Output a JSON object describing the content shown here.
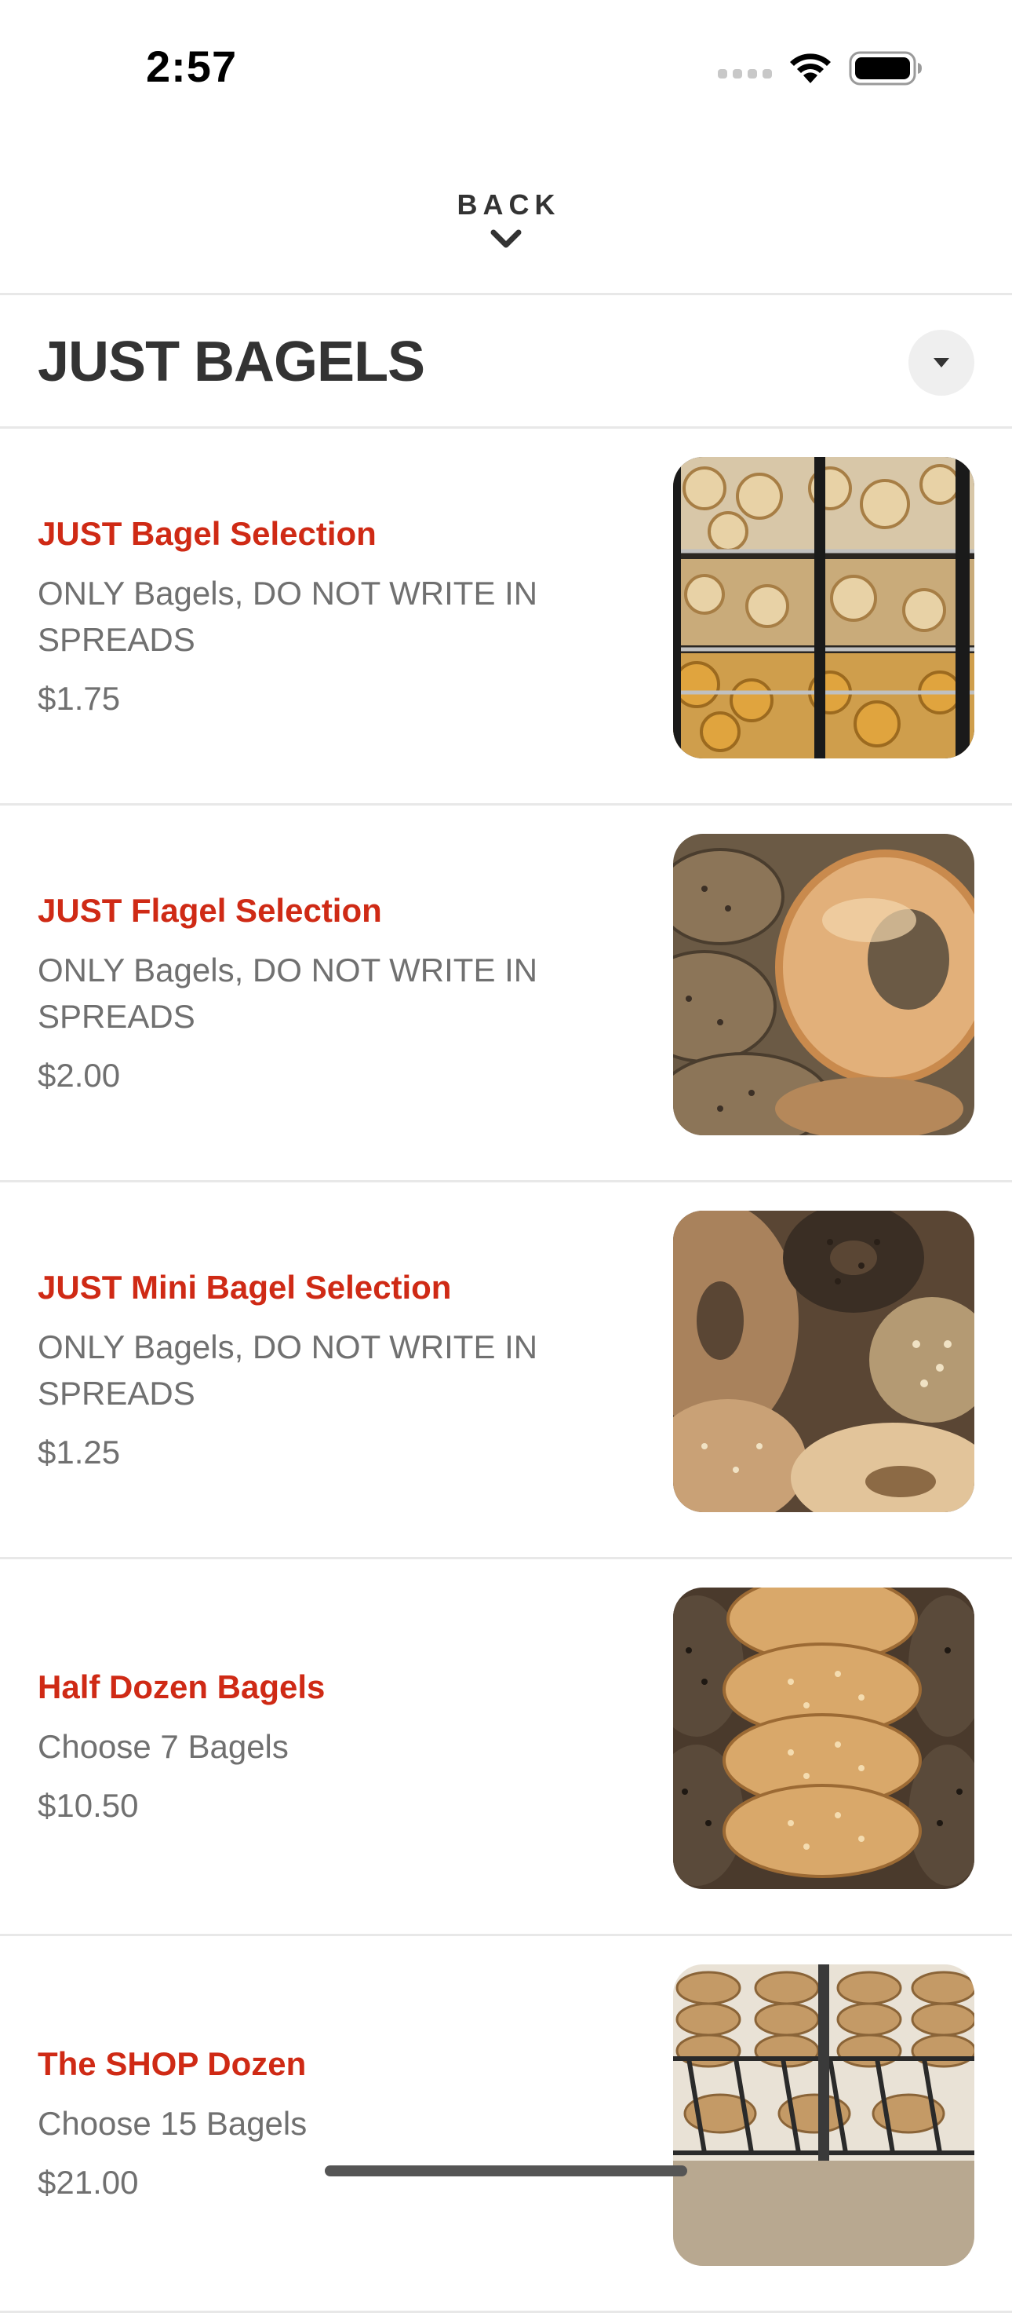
{
  "status_bar": {
    "time": "2:57",
    "icons": [
      "cellular-signal-icon",
      "wifi-icon",
      "battery-icon"
    ]
  },
  "header": {
    "back_label": "BACK",
    "back_icon": "chevron-down-icon"
  },
  "section": {
    "title": "JUST BAGELS",
    "toggle_icon": "caret-down-icon"
  },
  "items": [
    {
      "name": "JUST Bagel Selection",
      "description": "ONLY Bagels, DO NOT WRITE IN SPREADS",
      "price": "$1.75"
    },
    {
      "name": "JUST Flagel Selection",
      "description": "ONLY Bagels, DO NOT WRITE IN SPREADS",
      "price": "$2.00"
    },
    {
      "name": "JUST Mini Bagel Selection",
      "description": "ONLY Bagels, DO NOT WRITE IN SPREADS",
      "price": "$1.25"
    },
    {
      "name": "Half Dozen Bagels",
      "description": "Choose 7 Bagels",
      "price": "$10.50"
    },
    {
      "name": "The SHOP Dozen",
      "description": "Choose 15 Bagels",
      "price": "$21.00"
    }
  ],
  "colors": {
    "accent": "#cf2a15",
    "text_primary": "#333333",
    "text_secondary": "#707070",
    "divider": "#e8e8e8"
  }
}
